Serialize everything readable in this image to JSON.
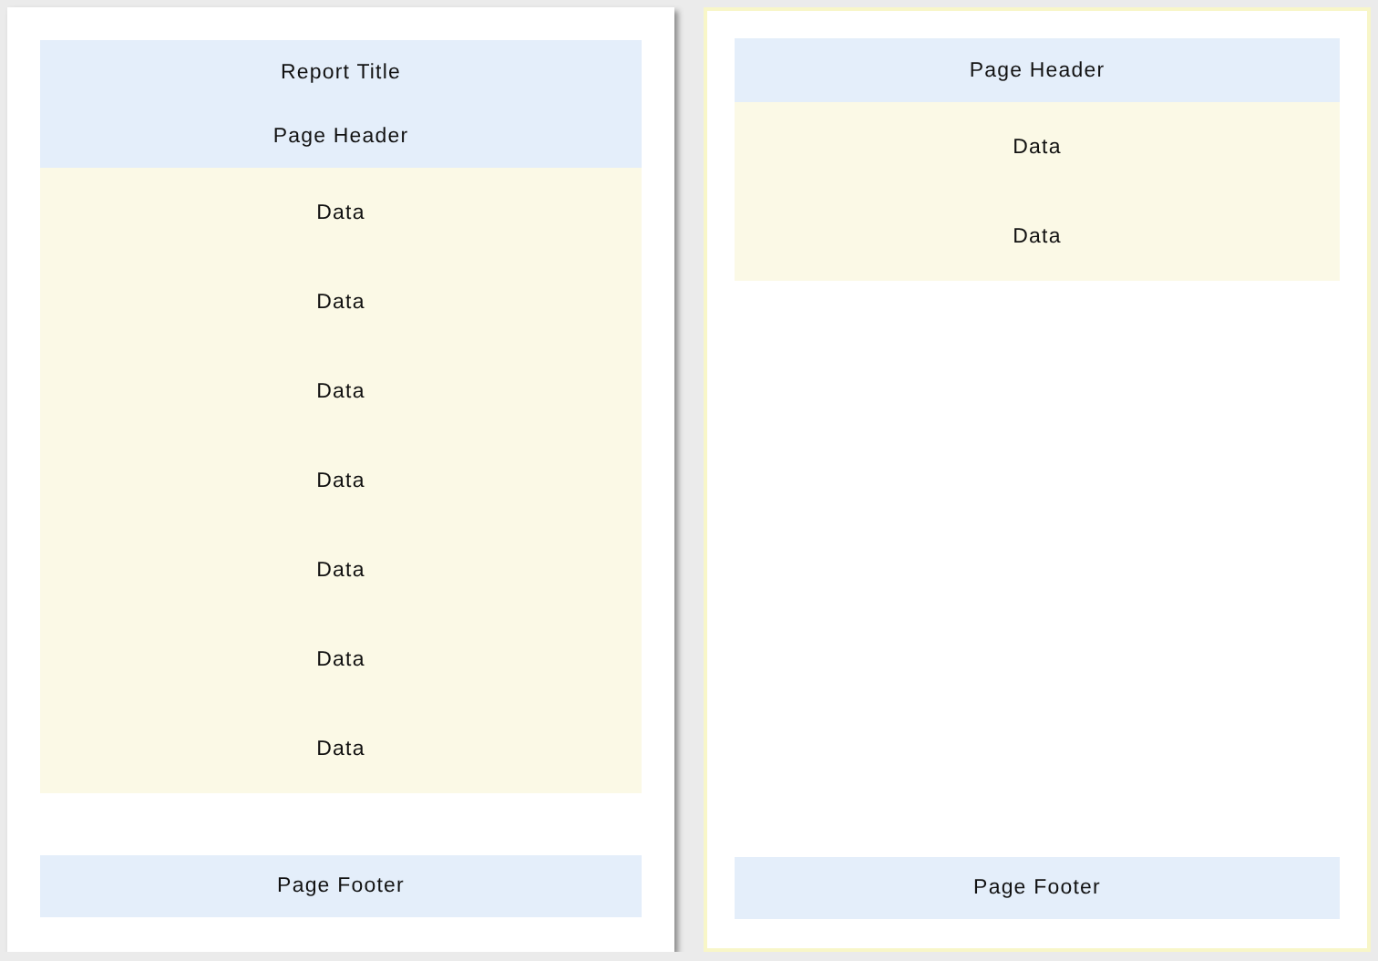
{
  "pages": [
    {
      "selected": false,
      "sections": [
        {
          "kind": "header",
          "lines": [
            "Report Title",
            "Page Header"
          ]
        },
        {
          "kind": "data",
          "lines": [
            "Data",
            "Data",
            "Data",
            "Data",
            "Data",
            "Data",
            "Data"
          ]
        },
        {
          "kind": "footer",
          "lines": [
            "Page Footer"
          ]
        }
      ]
    },
    {
      "selected": true,
      "sections": [
        {
          "kind": "header",
          "lines": [
            "Page Header"
          ]
        },
        {
          "kind": "data",
          "lines": [
            "Data",
            "Data"
          ]
        },
        {
          "kind": "footer",
          "lines": [
            "Page Footer"
          ]
        }
      ]
    }
  ]
}
